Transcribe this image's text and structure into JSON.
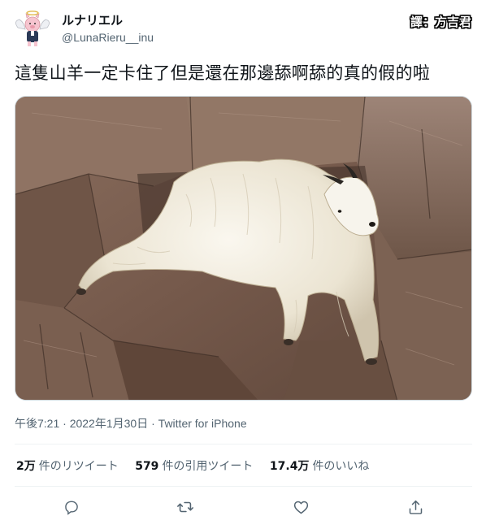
{
  "user": {
    "display_name": "ルナリエル",
    "handle": "@LunaRieru__inu",
    "avatar_icon": "angel-pig-avatar-icon"
  },
  "translator_credit": "譯：方吉君",
  "tweet": {
    "text": "這隻山羊一定卡住了但是還在那邊舔啊舔的真的假的啦",
    "media_icon": "mountain-goat-on-cliff-photo"
  },
  "meta": {
    "time": "午後7:21",
    "separator": " · ",
    "date": "2022年1月30日",
    "source": "Twitter for iPhone"
  },
  "stats": [
    {
      "number": "2万",
      "label": "件のリツイート"
    },
    {
      "number": "579",
      "label": "件の引用ツイート"
    },
    {
      "number": "17.4万",
      "label": "件のいいね"
    }
  ],
  "actions": [
    {
      "icon": "reply-icon"
    },
    {
      "icon": "retweet-icon"
    },
    {
      "icon": "like-heart-icon"
    },
    {
      "icon": "share-icon"
    }
  ],
  "colors": {
    "text": "#0f1419",
    "secondary": "#536471",
    "divider": "#eff3f4"
  }
}
